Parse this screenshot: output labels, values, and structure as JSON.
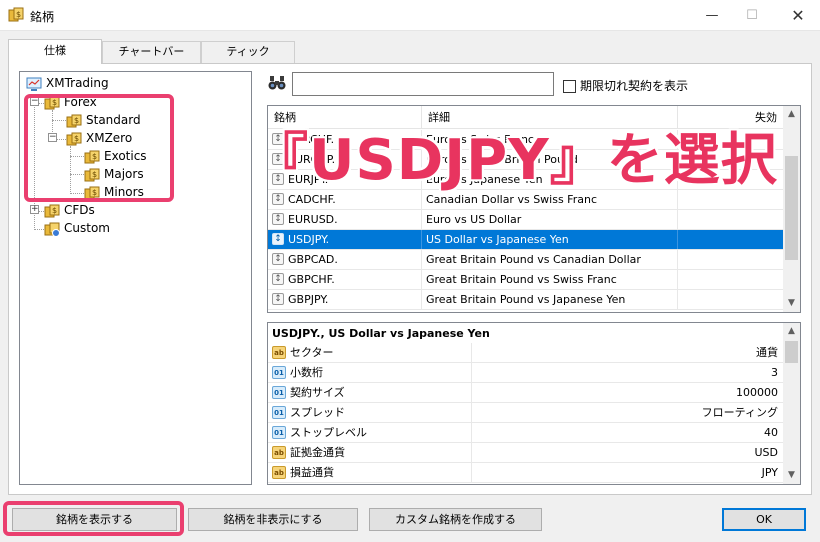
{
  "window": {
    "title": "銘柄",
    "minimize": "—",
    "maximize": "☐",
    "close": "✕"
  },
  "tabs": [
    {
      "label": "仕様"
    },
    {
      "label": "チャートバー"
    },
    {
      "label": "ティック"
    }
  ],
  "tree": {
    "root": "XMTrading",
    "forex": "Forex",
    "standard": "Standard",
    "xmzero": "XMZero",
    "exotics": "Exotics",
    "majors": "Majors",
    "minors": "Minors",
    "cfds": "CFDs",
    "custom": "Custom"
  },
  "search": {
    "value": "",
    "checkbox_label": "期限切れ契約を表示"
  },
  "table": {
    "columns": [
      "銘柄",
      "詳細",
      "失効"
    ],
    "rows": [
      {
        "symbol": "EURCHF.",
        "desc": "Euro vs Swiss Franc"
      },
      {
        "symbol": "EURGBP.",
        "desc": "Euro vs Great Britain Pound"
      },
      {
        "symbol": "EURJPY.",
        "desc": "Euro vs Japanese Yen"
      },
      {
        "symbol": "CADCHF.",
        "desc": "Canadian Dollar vs Swiss Franc"
      },
      {
        "symbol": "EURUSD.",
        "desc": "Euro vs US Dollar"
      },
      {
        "symbol": "USDJPY.",
        "desc": "US Dollar vs Japanese Yen"
      },
      {
        "symbol": "GBPCAD.",
        "desc": "Great Britain Pound vs Canadian Dollar"
      },
      {
        "symbol": "GBPCHF.",
        "desc": "Great Britain Pound vs Swiss Franc"
      },
      {
        "symbol": "GBPJPY.",
        "desc": "Great Britain Pound vs Japanese Yen"
      }
    ],
    "selected_index": 5
  },
  "overlay": {
    "text": "『USDJPY』を選択",
    "color": "#e8345f"
  },
  "properties": {
    "title": "USDJPY., US Dollar vs Japanese Yen",
    "rows": [
      {
        "name": "セクター",
        "value": "通貨",
        "icon": "ab"
      },
      {
        "name": "小数桁",
        "value": "3",
        "icon": "01"
      },
      {
        "name": "契約サイズ",
        "value": "100000",
        "icon": "01"
      },
      {
        "name": "スプレッド",
        "value": "フローティング",
        "icon": "01"
      },
      {
        "name": "ストップレベル",
        "value": "40",
        "icon": "01"
      },
      {
        "name": "証拠金通貨",
        "value": "USD",
        "icon": "ab"
      },
      {
        "name": "損益通貨",
        "value": "JPY",
        "icon": "ab"
      }
    ]
  },
  "buttons": {
    "show": "銘柄を表示する",
    "hide": "銘柄を非表示にする",
    "create_custom": "カスタム銘柄を作成する",
    "ok": "OK"
  },
  "colors": {
    "selection": "#0078d7",
    "highlight": "#ea3f6f"
  }
}
